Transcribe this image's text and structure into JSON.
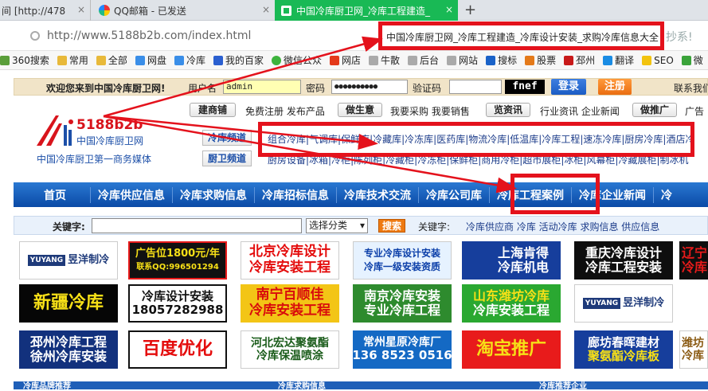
{
  "browser": {
    "tabs": [
      {
        "label": "间 [http://478",
        "close": "×"
      },
      {
        "label": "QQ邮箱 - 已发送",
        "close": "×"
      },
      {
        "label": "中国冷库厨卫网_冷库工程建造_",
        "close": "×"
      }
    ],
    "new_tab": "+",
    "url": "http://www.5188b2b.com/index.html",
    "page_title": "中国冷库厨卫网_冷库工程建造_冷库设计安装_求购冷库信息大全",
    "drag_hint": "抄系!"
  },
  "bookmarks": [
    "360搜索",
    "常用",
    "全部",
    "网盘",
    "冷库",
    "我的百家",
    "微信公众",
    "网店",
    "牛散",
    "后台",
    "网站",
    "搜标",
    "股票",
    "邳州",
    "翻译",
    "SEO",
    "微"
  ],
  "login": {
    "welcome": "欢迎您来到中国冷库厨卫网!",
    "username_label": "用户名",
    "username_value": "admin",
    "password_label": "密码",
    "password_value": "●●●●●●●●●●",
    "captcha_label": "验证码",
    "captcha_image": "fnef",
    "login_button": "登录",
    "register_button": "注册",
    "contact": "联系我们"
  },
  "logo": {
    "name": "5188b2b",
    "subtitle": "中国冷库厨卫网",
    "tagline": "中国冷库厨卫第一商务媒体"
  },
  "quicklinks": {
    "shop_button": "建商铺",
    "shop_text": "免费注册  发布产品",
    "biz_button": "做生意",
    "biz_text": "我要采购  我要销售",
    "news_button": "览资讯",
    "news_text": "行业资讯  企业新闻",
    "ad_button": "做推广",
    "ad_text": "广告"
  },
  "channels": {
    "cold_label": "冷库频道",
    "cold_links": "组合冷库|气调库|保鲜库|冷藏库|冷冻库|医药库|物流冷库|低温库|冷库工程|速冻冷库|厨房冷库|酒店冷",
    "kitchen_label": "厨卫频道",
    "kitchen_links": "厨房设备|冰箱|冷柜|陈列柜|冷藏柜|冷冻柜|保鲜柜|商用冷柜|超市展柜|冰柜|风幕柜|冷藏展柜|制冰机"
  },
  "nav": [
    "首页",
    "冷库供应信息",
    "冷库求购信息",
    "冷库招标信息",
    "冷库技术交流",
    "冷库公司库",
    "冷库工程案例",
    "冷库企业新闻",
    "冷"
  ],
  "search": {
    "keyword_label": "关键字:",
    "category": "选择分类",
    "button": "搜索",
    "hot_label": "关键字:",
    "hot_links": "冷库供应商   冷库   活动冷库   求购信息   供应信息"
  },
  "ads": [
    {
      "line1": "YUYANG",
      "line2": "昱洋制冷"
    },
    {
      "line1": "广告位1800元/年",
      "line2": "联系QQ:996501294"
    },
    {
      "line1": "北京冷库设计",
      "line2": "冷库安装工程"
    },
    {
      "line1": "专业冷库设计安装",
      "line2": "冷库一级安装资质"
    },
    {
      "line1": "上海肯得",
      "line2": "冷库机电"
    },
    {
      "line1": "重庆冷库设计",
      "line2": "冷库工程安装"
    },
    {
      "line1": "辽宁",
      "line2": "冷库"
    },
    {
      "line1": "新疆冷库",
      "line2": ""
    },
    {
      "line1": "冷库设计安装",
      "line2": "18057282988"
    },
    {
      "line1": "南宁百顺佳",
      "line2": "冷库安装工程"
    },
    {
      "line1": "南京冷库安装",
      "line2": "专业冷库工程"
    },
    {
      "line1": "山东潍坊冷库",
      "line2": "冷库安装工程"
    },
    {
      "line1": "YUYANG",
      "line2": "昱洋制冷"
    },
    {
      "line1": "邳州冷库工程",
      "line2": "徐州冷库安装"
    },
    {
      "line1": "百度优化",
      "line2": ""
    },
    {
      "line1": "河北宏达聚氨酯",
      "line2": "冷库保温喷涂"
    },
    {
      "line1": "常州星原冷库厂",
      "line2": "136 8523 0516"
    },
    {
      "line1": "淘宝推广",
      "line2": ""
    },
    {
      "line1": "廊坊春晖建材",
      "line2": "聚氨酯冷库板"
    },
    {
      "line1": "潍坊",
      "line2": "冷库"
    }
  ],
  "bottom_sections": [
    "冷库品牌推荐",
    "冷库求购信息",
    "冷库推荐企业"
  ],
  "colors": {
    "annotation_red": "#e4121c",
    "nav_blue": "#1656b4",
    "active_tab_green": "#19b955"
  }
}
